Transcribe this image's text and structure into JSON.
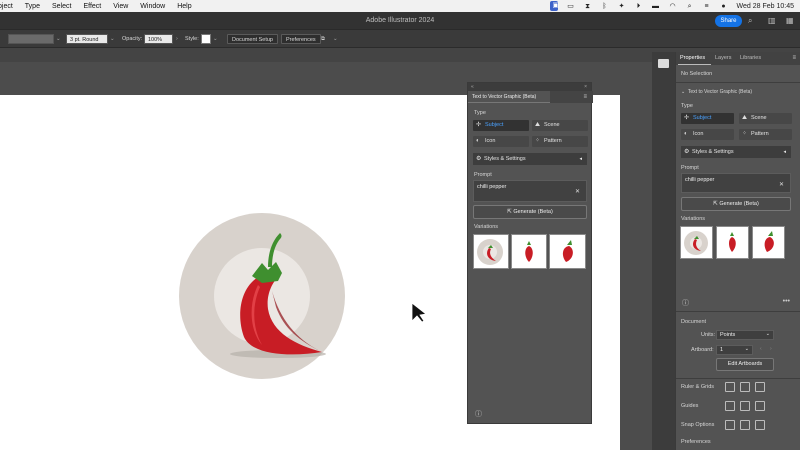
{
  "menubar": {
    "items": [
      "bject",
      "Type",
      "Select",
      "Effect",
      "View",
      "Window",
      "Help"
    ],
    "clock": "Wed 28 Feb  10:45"
  },
  "app": {
    "title": "Adobe Illustrator 2024",
    "share_label": "Share"
  },
  "controlbar": {
    "stroke_value": "3 pt. Round",
    "opacity_label": "Opacity:",
    "opacity_value": "100%",
    "style_label": "Style:",
    "document_setup": "Document Setup",
    "preferences": "Preferences"
  },
  "t2v_panel": {
    "tab_title": "Text to Vector Graphic (Beta)",
    "type_label": "Type",
    "types": [
      {
        "label": "Subject",
        "icon": "subject-icon",
        "active": true
      },
      {
        "label": "Scene",
        "icon": "scene-icon",
        "active": false
      },
      {
        "label": "Icon",
        "icon": "icon-type-icon",
        "active": false
      },
      {
        "label": "Pattern",
        "icon": "pattern-icon",
        "active": false
      }
    ],
    "styles_label": "Styles & Settings",
    "prompt_label": "Prompt",
    "prompt_value": "chilli pepper",
    "generate_label": "Generate (Beta)",
    "variations_label": "Variations"
  },
  "properties": {
    "tabs": [
      "Properties",
      "Layers",
      "Libraries"
    ],
    "selection": "No Selection",
    "section_title": "Text to Vector Graphic (Beta)",
    "type_label": "Type",
    "types": [
      {
        "label": "Subject",
        "active": true
      },
      {
        "label": "Scene",
        "active": false
      },
      {
        "label": "Icon",
        "active": false
      },
      {
        "label": "Pattern",
        "active": false
      }
    ],
    "styles_label": "Styles & Settings",
    "prompt_label": "Prompt",
    "prompt_value": "chilli pepper",
    "generate_label": "Generate (Beta)",
    "variations_label": "Variations",
    "document_label": "Document",
    "units_label": "Units:",
    "units_value": "Points",
    "artboard_label": "Artboard:",
    "artboard_value": "1",
    "edit_artboards": "Edit Artboards",
    "ruler_grids": "Ruler & Grids",
    "guides": "Guides",
    "snap_options": "Snap Options",
    "preferences": "Preferences"
  },
  "colors": {
    "accent": "#1473e6",
    "active_text": "#4aa2ff",
    "pepper_red": "#c81d25",
    "stem_green": "#3f8f2f",
    "backdrop": "#d8d2cc"
  }
}
